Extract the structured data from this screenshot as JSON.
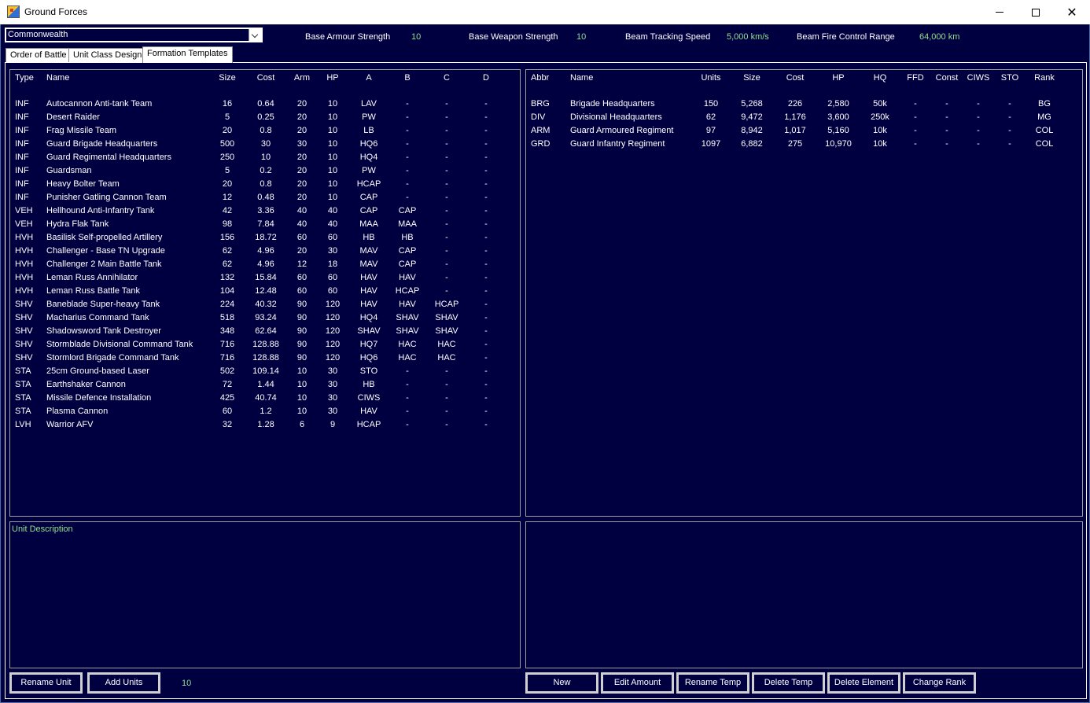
{
  "window": {
    "title": "Ground Forces"
  },
  "race": {
    "selected": "Commonwealth"
  },
  "stats": [
    {
      "label": "Base Armour Strength",
      "value": "10"
    },
    {
      "label": "Base Weapon Strength",
      "value": "10"
    },
    {
      "label": "Beam Tracking Speed",
      "value": "5,000 km/s"
    },
    {
      "label": "Beam Fire Control Range",
      "value": "64,000 km"
    }
  ],
  "tabs": [
    {
      "label": "Order of Battle"
    },
    {
      "label": "Unit Class Design"
    },
    {
      "label": "Formation Templates"
    }
  ],
  "units": {
    "headers": [
      "Type",
      "Name",
      "Size",
      "Cost",
      "Arm",
      "HP",
      "A",
      "B",
      "C",
      "D"
    ],
    "rows": [
      [
        "INF",
        "Autocannon Anti-tank Team",
        "16",
        "0.64",
        "20",
        "10",
        "LAV",
        "-",
        "-",
        "-"
      ],
      [
        "INF",
        "Desert Raider",
        "5",
        "0.25",
        "20",
        "10",
        "PW",
        "-",
        "-",
        "-"
      ],
      [
        "INF",
        "Frag Missile Team",
        "20",
        "0.8",
        "20",
        "10",
        "LB",
        "-",
        "-",
        "-"
      ],
      [
        "INF",
        "Guard Brigade Headquarters",
        "500",
        "30",
        "30",
        "10",
        "HQ6",
        "-",
        "-",
        "-"
      ],
      [
        "INF",
        "Guard Regimental Headquarters",
        "250",
        "10",
        "20",
        "10",
        "HQ4",
        "-",
        "-",
        "-"
      ],
      [
        "INF",
        "Guardsman",
        "5",
        "0.2",
        "20",
        "10",
        "PW",
        "-",
        "-",
        "-"
      ],
      [
        "INF",
        "Heavy Bolter Team",
        "20",
        "0.8",
        "20",
        "10",
        "HCAP",
        "-",
        "-",
        "-"
      ],
      [
        "INF",
        "Punisher Gatling Cannon Team",
        "12",
        "0.48",
        "20",
        "10",
        "CAP",
        "-",
        "-",
        "-"
      ],
      [
        "VEH",
        "Hellhound Anti-Infantry Tank",
        "42",
        "3.36",
        "40",
        "40",
        "CAP",
        "CAP",
        "-",
        "-"
      ],
      [
        "VEH",
        "Hydra Flak Tank",
        "98",
        "7.84",
        "40",
        "40",
        "MAA",
        "MAA",
        "-",
        "-"
      ],
      [
        "HVH",
        "Basilisk Self-propelled Artillery",
        "156",
        "18.72",
        "60",
        "60",
        "HB",
        "HB",
        "-",
        "-"
      ],
      [
        "HVH",
        "Challenger - Base TN Upgrade",
        "62",
        "4.96",
        "20",
        "30",
        "MAV",
        "CAP",
        "-",
        "-"
      ],
      [
        "HVH",
        "Challenger 2 Main Battle Tank",
        "62",
        "4.96",
        "12",
        "18",
        "MAV",
        "CAP",
        "-",
        "-"
      ],
      [
        "HVH",
        "Leman Russ Annihilator",
        "132",
        "15.84",
        "60",
        "60",
        "HAV",
        "HAV",
        "-",
        "-"
      ],
      [
        "HVH",
        "Leman Russ Battle Tank",
        "104",
        "12.48",
        "60",
        "60",
        "HAV",
        "HCAP",
        "-",
        "-"
      ],
      [
        "SHV",
        "Baneblade Super-heavy Tank",
        "224",
        "40.32",
        "90",
        "120",
        "HAV",
        "HAV",
        "HCAP",
        "-"
      ],
      [
        "SHV",
        "Macharius Command Tank",
        "518",
        "93.24",
        "90",
        "120",
        "HQ4",
        "SHAV",
        "SHAV",
        "-"
      ],
      [
        "SHV",
        "Shadowsword Tank Destroyer",
        "348",
        "62.64",
        "90",
        "120",
        "SHAV",
        "SHAV",
        "SHAV",
        "-"
      ],
      [
        "SHV",
        "Stormblade Divisional Command Tank",
        "716",
        "128.88",
        "90",
        "120",
        "HQ7",
        "HAC",
        "HAC",
        "-"
      ],
      [
        "SHV",
        "Stormlord Brigade Command Tank",
        "716",
        "128.88",
        "90",
        "120",
        "HQ6",
        "HAC",
        "HAC",
        "-"
      ],
      [
        "STA",
        "25cm Ground-based Laser",
        "502",
        "109.14",
        "10",
        "30",
        "STO",
        "-",
        "-",
        "-"
      ],
      [
        "STA",
        "Earthshaker Cannon",
        "72",
        "1.44",
        "10",
        "30",
        "HB",
        "-",
        "-",
        "-"
      ],
      [
        "STA",
        "Missile Defence Installation",
        "425",
        "40.74",
        "10",
        "30",
        "CIWS",
        "-",
        "-",
        "-"
      ],
      [
        "STA",
        "Plasma Cannon",
        "60",
        "1.2",
        "10",
        "30",
        "HAV",
        "-",
        "-",
        "-"
      ],
      [
        "LVH",
        "Warrior AFV",
        "32",
        "1.28",
        "6",
        "9",
        "HCAP",
        "-",
        "-",
        "-"
      ]
    ]
  },
  "templates": {
    "headers": [
      "Abbr",
      "Name",
      "Units",
      "Size",
      "Cost",
      "HP",
      "HQ",
      "FFD",
      "Const",
      "CIWS",
      "STO",
      "Rank"
    ],
    "rows": [
      [
        "BRG",
        "Brigade Headquarters",
        "150",
        "5,268",
        "226",
        "2,580",
        "50k",
        "-",
        "-",
        "-",
        "-",
        "BG"
      ],
      [
        "DIV",
        "Divisional Headquarters",
        "62",
        "9,472",
        "1,176",
        "3,600",
        "250k",
        "-",
        "-",
        "-",
        "-",
        "MG"
      ],
      [
        "ARM",
        "Guard Armoured Regiment",
        "97",
        "8,942",
        "1,017",
        "5,160",
        "10k",
        "-",
        "-",
        "-",
        "-",
        "COL"
      ],
      [
        "GRD",
        "Guard Infantry Regiment",
        "1097",
        "6,882",
        "275",
        "10,970",
        "10k",
        "-",
        "-",
        "-",
        "-",
        "COL"
      ]
    ]
  },
  "description": {
    "label": "Unit Description"
  },
  "left_buttons": [
    {
      "label": "Rename Unit"
    },
    {
      "label": "Add Units"
    }
  ],
  "add_count": "10",
  "right_buttons": [
    {
      "label": "New"
    },
    {
      "label": "Edit Amount"
    },
    {
      "label": "Rename Temp"
    },
    {
      "label": "Delete Temp"
    },
    {
      "label": "Delete Element"
    },
    {
      "label": "Change Rank"
    }
  ],
  "colors": {
    "background": "#000040",
    "value_text": "#8fdf8f",
    "label_text": "#ffffff"
  }
}
